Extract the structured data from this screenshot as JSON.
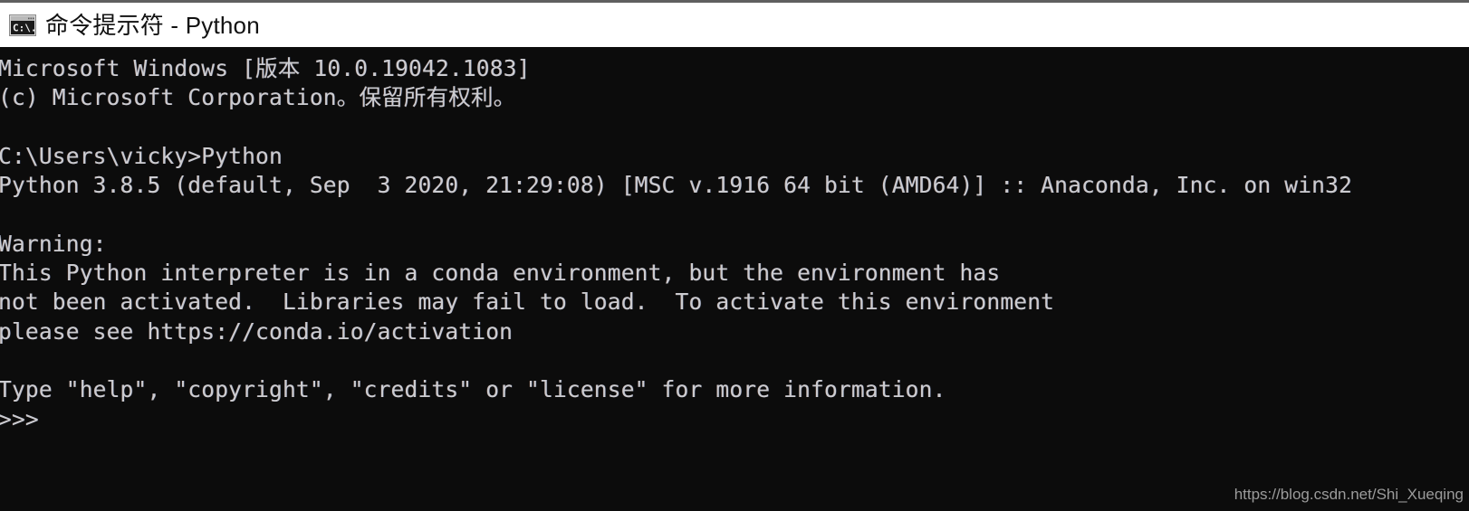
{
  "window": {
    "title": "命令提示符 - Python",
    "icon": "cmd-prompt-icon",
    "titlebar_bg": "#ffffff",
    "console_bg": "#0c0c0c",
    "console_fg": "#ccccd0"
  },
  "console": {
    "lines": [
      "Microsoft Windows [版本 10.0.19042.1083]",
      "(c) Microsoft Corporation。保留所有权利。",
      "",
      "C:\\Users\\vicky>Python",
      "Python 3.8.5 (default, Sep  3 2020, 21:29:08) [MSC v.1916 64 bit (AMD64)] :: Anaconda, Inc. on win32",
      "",
      "Warning:",
      "This Python interpreter is in a conda environment, but the environment has",
      "not been activated.  Libraries may fail to load.  To activate this environment",
      "please see https://conda.io/activation",
      "",
      "Type \"help\", \"copyright\", \"credits\" or \"license\" for more information.",
      ">>>"
    ],
    "prompt": ">>>",
    "working_directory": "C:\\Users\\vicky",
    "command_entered": "Python",
    "python_version": "3.8.5",
    "distribution": "Anaconda, Inc.",
    "platform": "win32"
  },
  "watermark": {
    "text": "https://blog.csdn.net/Shi_Xueqing"
  }
}
